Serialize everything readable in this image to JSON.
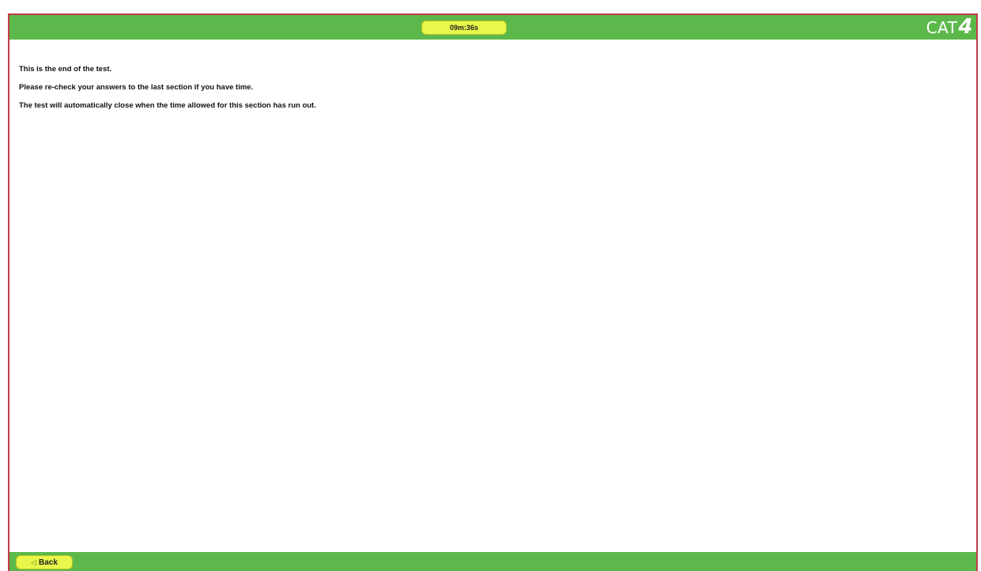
{
  "header": {
    "timer": "09m:36s",
    "logo_text": "CAT",
    "logo_number": "4"
  },
  "main": {
    "lines": [
      "This is the end of the test.",
      "Please re-check your answers to the last section if you have time.",
      "The test will automatically close when the time allowed for this section has run out."
    ]
  },
  "footer": {
    "back_label": "Back",
    "back_icon": "arrow-left-icon"
  },
  "colors": {
    "bar_green": "#5cb84a",
    "button_yellow": "#e8f74a",
    "frame_red": "#c53a4b"
  }
}
